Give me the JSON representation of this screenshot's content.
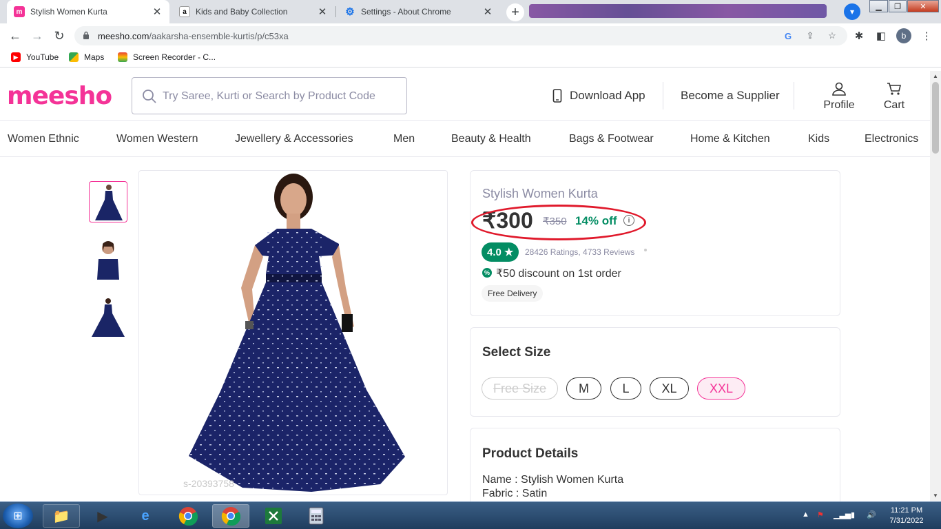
{
  "browser": {
    "tabs": [
      {
        "title": "Stylish Women Kurta",
        "favicon": "meesho-icon"
      },
      {
        "title": "Kids and Baby Collection",
        "favicon": "amazon-icon"
      },
      {
        "title": "Settings - About Chrome",
        "favicon": "settings-gear-icon"
      }
    ],
    "url_host": "meesho.com",
    "url_path": "/aakarsha-ensemble-kurtis/p/c53xa",
    "profile_initial": "b"
  },
  "bookmarks": [
    {
      "label": "YouTube",
      "icon": "youtube-icon"
    },
    {
      "label": "Maps",
      "icon": "maps-icon"
    },
    {
      "label": "Screen Recorder - C...",
      "icon": "screen-recorder-icon"
    }
  ],
  "site": {
    "logo": "meesho",
    "brand_color": "#f43397",
    "search_placeholder": "Try Saree, Kurti or Search by Product Code",
    "download_app": "Download App",
    "become_supplier": "Become a Supplier",
    "profile": "Profile",
    "cart": "Cart",
    "categories": [
      "Women Ethnic",
      "Women Western",
      "Jewellery & Accessories",
      "Men",
      "Beauty & Health",
      "Bags & Footwear",
      "Home & Kitchen",
      "Kids",
      "Electronics"
    ]
  },
  "product": {
    "title": "Stylish Women Kurta",
    "price": "₹300",
    "mrp": "₹350",
    "discount": "14% off",
    "rating": "4.0 ★",
    "rating_count": "28426 Ratings, 4733 Reviews",
    "first_order_discount": "₹50 discount on 1st order",
    "delivery": "Free Delivery",
    "watermark": "s-20393758",
    "accent_green": "#038d63"
  },
  "size_section": {
    "title": "Select Size",
    "sizes": [
      "Free Size",
      "M",
      "L",
      "XL",
      "XXL"
    ],
    "selected": "XXL",
    "unavailable": "Free Size"
  },
  "details": {
    "title": "Product Details",
    "name_line": "Name : Stylish Women Kurta",
    "fabric_line": "Fabric : Satin"
  },
  "taskbar": {
    "time": "11:21 PM",
    "date": "7/31/2022"
  }
}
